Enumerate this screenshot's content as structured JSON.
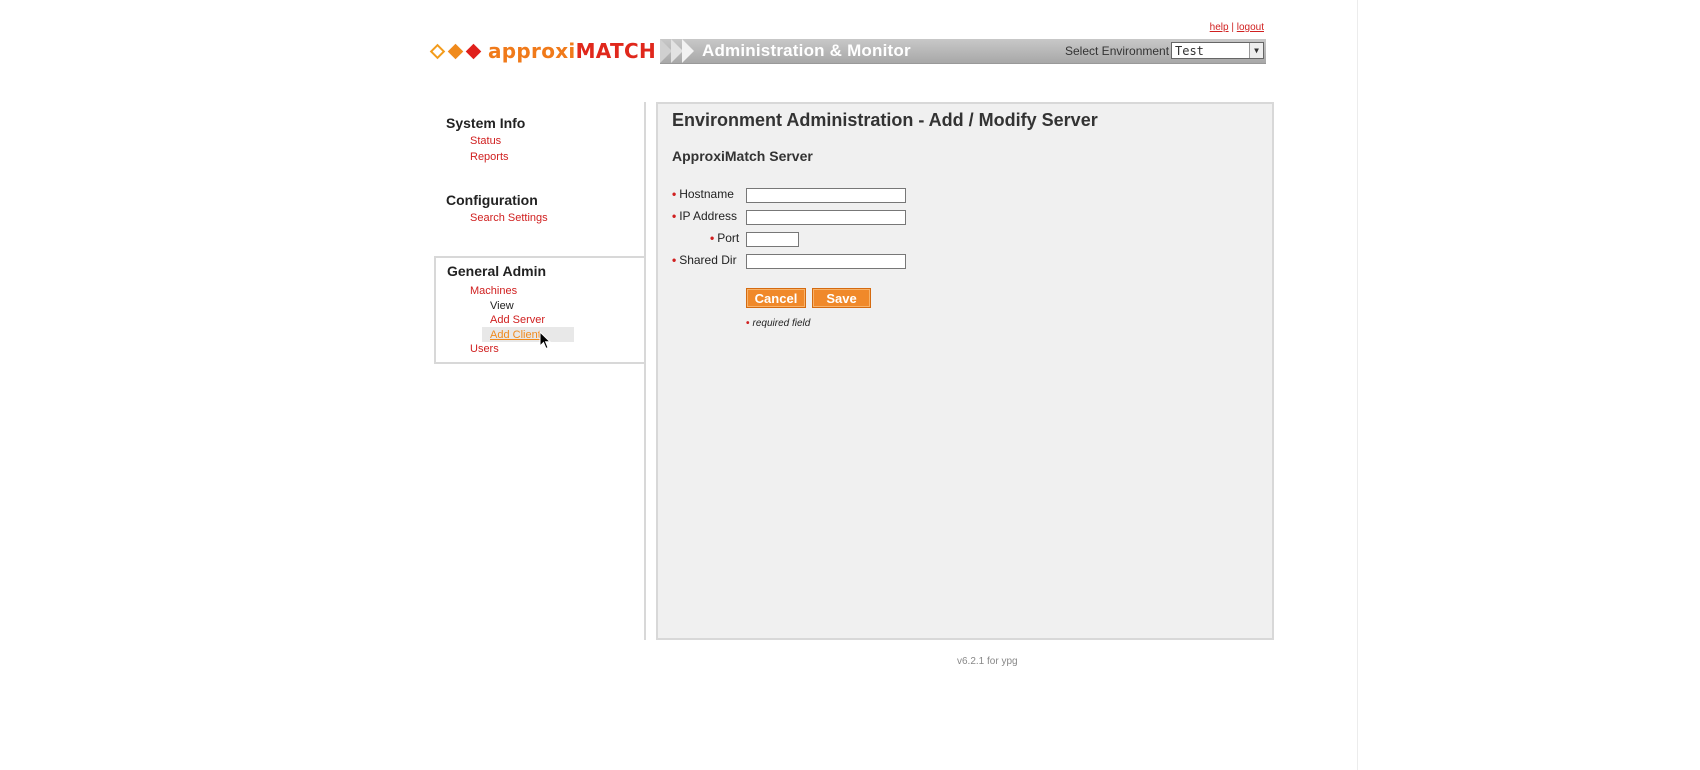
{
  "header": {
    "logo_prefix": "approxi",
    "logo_suffix": "MATCH",
    "title": "Administration & Monitor",
    "env_label": "Select Environment :",
    "env_value": "Test",
    "help": "help",
    "sep": "|",
    "logout": "logout"
  },
  "sidebar": {
    "system_info": {
      "title": "System Info",
      "items": [
        "Status",
        "Reports"
      ]
    },
    "configuration": {
      "title": "Configuration",
      "items": [
        "Search Settings"
      ]
    },
    "general_admin": {
      "title": "General Admin",
      "machines": "Machines",
      "sub_items": [
        "View",
        "Add Server",
        "Add Client"
      ],
      "users": "Users"
    }
  },
  "main": {
    "title": "Environment Administration - Add / Modify Server",
    "subtitle": "ApproxiMatch Server",
    "req_marker": "•",
    "fields": [
      {
        "label": "Hostname",
        "value": ""
      },
      {
        "label": "IP Address",
        "value": ""
      },
      {
        "label": "Port",
        "value": ""
      },
      {
        "label": "Shared Dir",
        "value": ""
      }
    ],
    "cancel": "Cancel",
    "save": "Save",
    "required_note": "required field"
  },
  "footer": {
    "version": "v6.2.1 for ypg"
  },
  "colors": {
    "accent": "#f0892a",
    "link": "#d02020",
    "panel": "#f0f0f0"
  }
}
